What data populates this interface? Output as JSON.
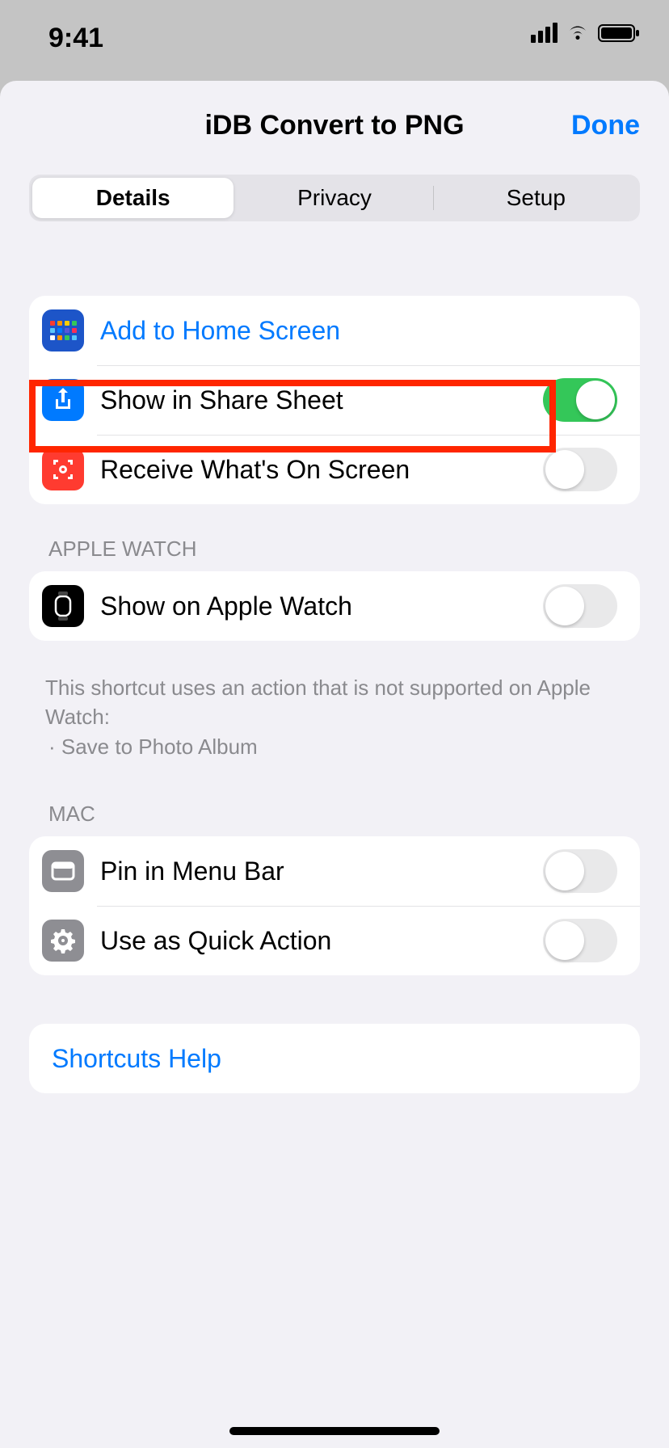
{
  "status": {
    "time": "9:41"
  },
  "header": {
    "title": "iDB Convert to PNG",
    "done": "Done"
  },
  "tabs": {
    "details": "Details",
    "privacy": "Privacy",
    "setup": "Setup"
  },
  "rows": {
    "addHome": "Add to Home Screen",
    "shareSheet": "Show in Share Sheet",
    "receiveScreen": "Receive What's On Screen",
    "appleWatch": "Show on Apple Watch",
    "pinMenuBar": "Pin in Menu Bar",
    "quickAction": "Use as Quick Action",
    "help": "Shortcuts Help"
  },
  "sections": {
    "appleWatchHeader": "Apple Watch",
    "macHeader": "Mac",
    "watchFooterLine1": "This shortcut uses an action that is not supported on Apple Watch:",
    "watchFooterBullet": "· Save to Photo Album"
  },
  "toggles": {
    "shareSheet": true,
    "receiveScreen": false,
    "appleWatch": false,
    "pinMenuBar": false,
    "quickAction": false
  }
}
